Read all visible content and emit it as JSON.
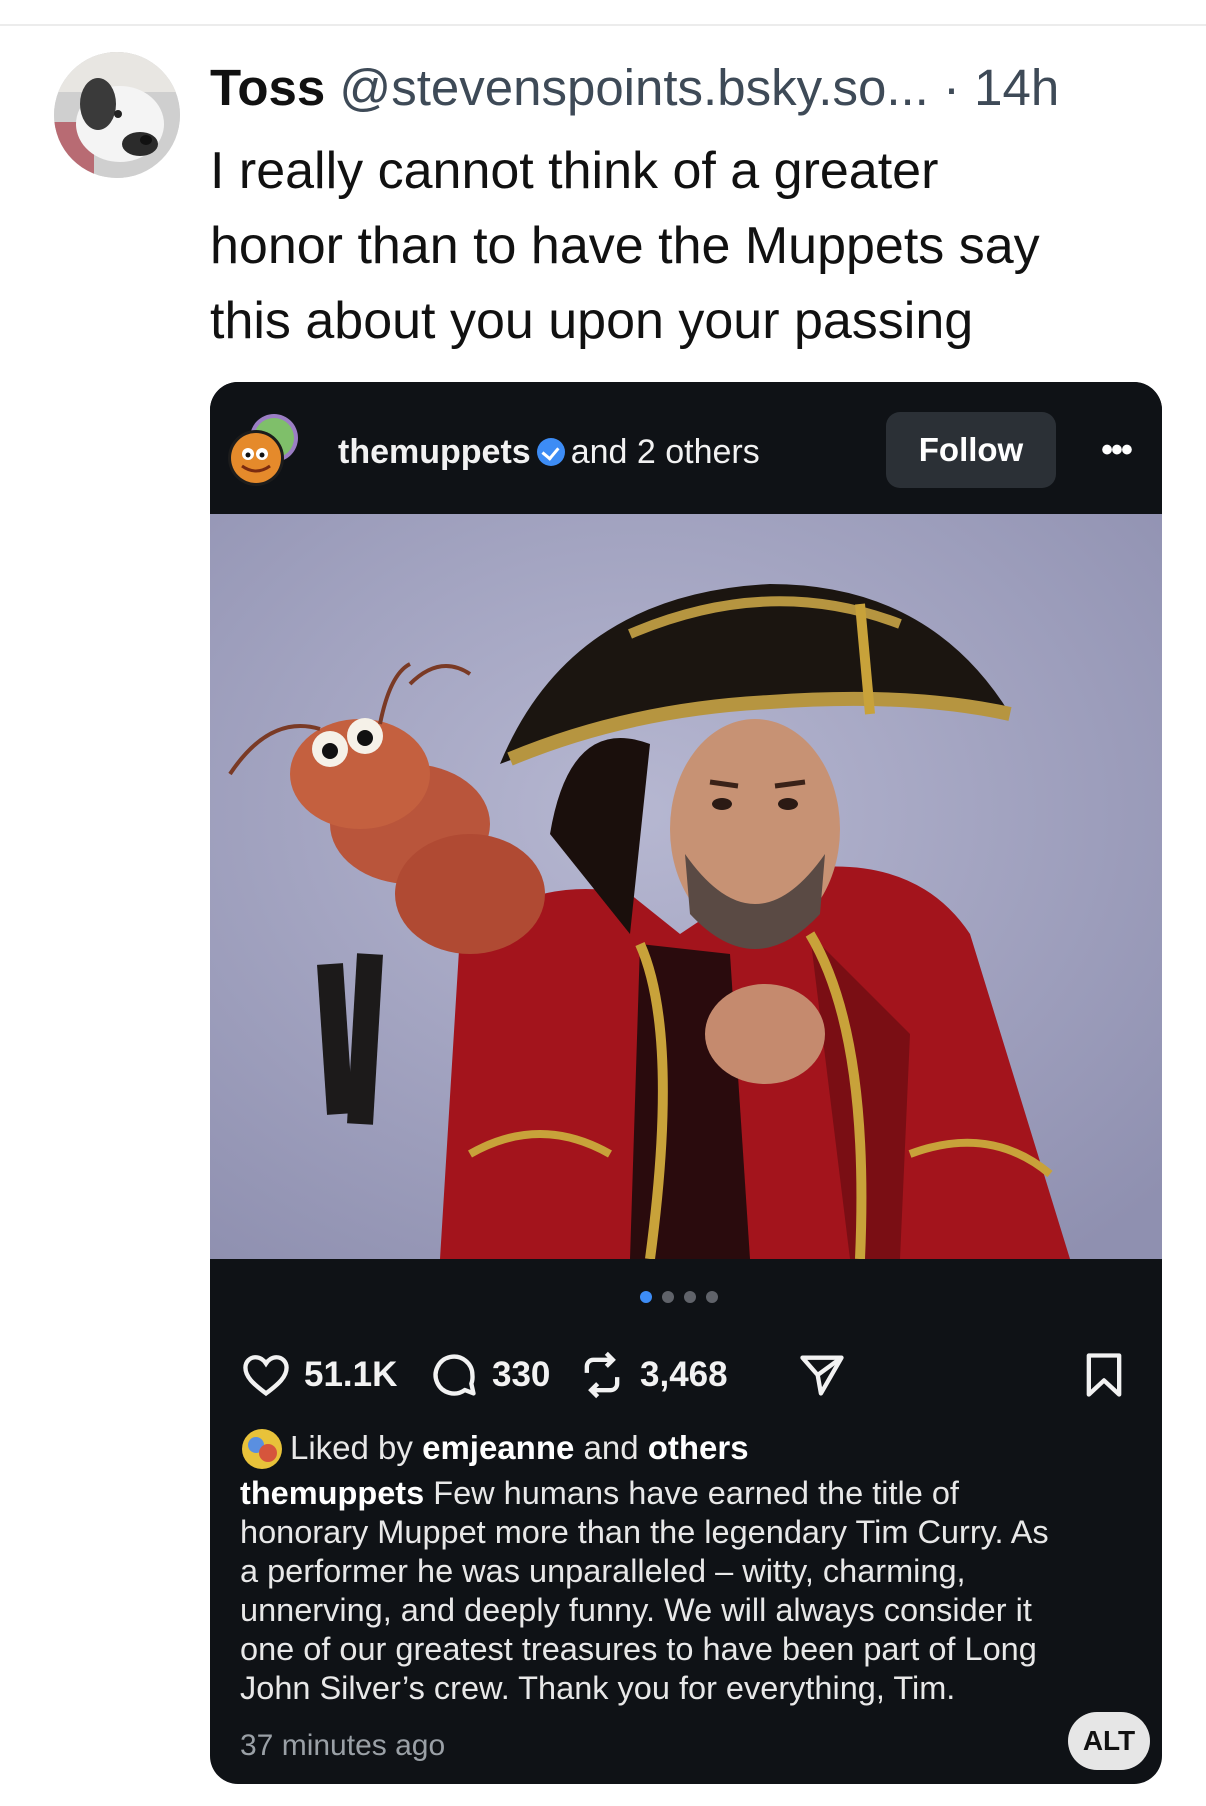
{
  "post": {
    "display_name": "Toss",
    "handle": "@stevenspoints.bsky.so...",
    "separator": "·",
    "time": "14h",
    "text_lines": [
      "I really cannot think of a greater",
      "honor than to have the Muppets say",
      "this about you upon your passing"
    ]
  },
  "embed": {
    "username": "themuppets",
    "collab_text": "and 2 others",
    "follow_label": "Follow",
    "more_label": "•••",
    "carousel": {
      "total": 4,
      "active": 1
    },
    "stats": {
      "likes": "51.1K",
      "comments": "330",
      "reposts": "3,468"
    },
    "liked_by": {
      "prefix": "Liked by",
      "user": "emjeanne",
      "middle": "and",
      "others": "others"
    },
    "caption": {
      "user": "themuppets",
      "lines": [
        "Few humans have earned the title of",
        "honorary Muppet more than the legendary Tim Curry. As",
        "a performer he was unparalleled – witty, charming,",
        "unnerving, and deeply funny. We will always consider it",
        "one of our greatest treasures to have been part of Long",
        "John Silver’s crew. Thank you for everything, Tim."
      ]
    },
    "time_ago": "37 minutes ago",
    "alt_label": "ALT"
  },
  "colors": {
    "embed_bg": "#0f1216",
    "verified_blue": "#3d8cf5",
    "photo_bg": "#a5a6c4"
  }
}
